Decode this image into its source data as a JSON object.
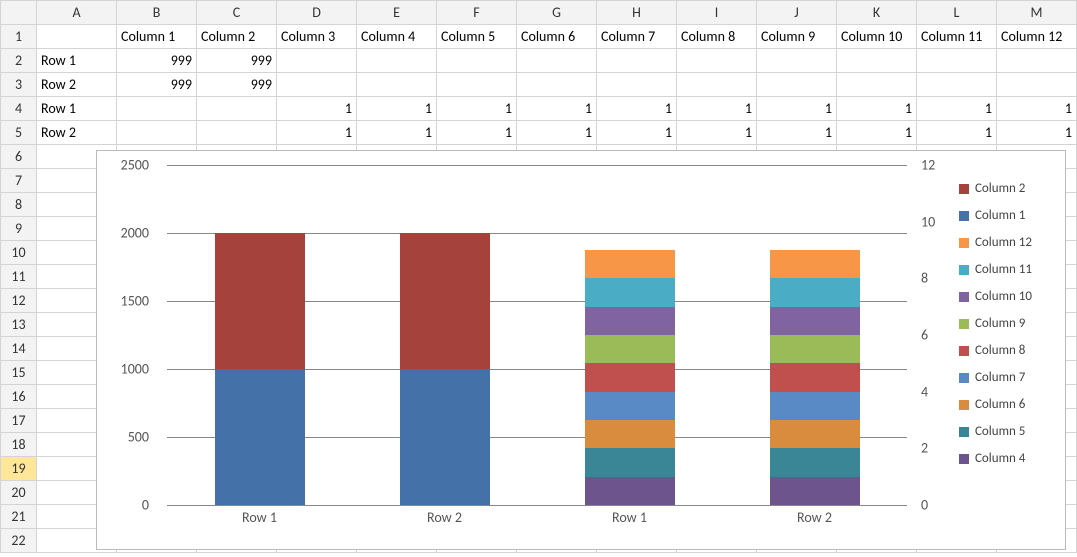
{
  "spreadsheet": {
    "col_headers": [
      "A",
      "B",
      "C",
      "D",
      "E",
      "F",
      "G",
      "H",
      "I",
      "J",
      "K",
      "L",
      "M"
    ],
    "row_headers": [
      "1",
      "2",
      "3",
      "4",
      "5",
      "6",
      "7",
      "8",
      "9",
      "10",
      "11",
      "12",
      "13",
      "14",
      "15",
      "16",
      "17",
      "18",
      "19",
      "20",
      "21",
      "22"
    ],
    "selected_row": "19",
    "header_row": {
      "B": "Column 1",
      "C": "Column 2",
      "D": "Column 3",
      "E": "Column 4",
      "F": "Column 5",
      "G": "Column 6",
      "H": "Column 7",
      "I": "Column 8",
      "J": "Column 9",
      "K": "Column 10",
      "L": "Column 11",
      "M": "Column 12"
    },
    "rows": {
      "2": {
        "A": "Row 1",
        "B": "999",
        "C": "999"
      },
      "3": {
        "A": "Row 2",
        "B": "999",
        "C": "999"
      },
      "4": {
        "A": "Row 1",
        "D": "1",
        "E": "1",
        "F": "1",
        "G": "1",
        "H": "1",
        "I": "1",
        "J": "1",
        "K": "1",
        "L": "1",
        "M": "1"
      },
      "5": {
        "A": "Row 2",
        "D": "1",
        "E": "1",
        "F": "1",
        "G": "1",
        "H": "1",
        "I": "1",
        "J": "1",
        "K": "1",
        "L": "1",
        "M": "1"
      }
    }
  },
  "chart_data": {
    "type": "bar",
    "stacked": true,
    "categories_left": [
      "Row 1",
      "Row 2"
    ],
    "categories_right": [
      "Row 1",
      "Row 2"
    ],
    "y_left": {
      "min": 0,
      "max": 2500,
      "ticks": [
        0,
        500,
        1000,
        1500,
        2000,
        2500
      ]
    },
    "y_right": {
      "min": 0,
      "max": 12,
      "ticks": [
        0,
        2,
        4,
        6,
        8,
        10,
        12
      ]
    },
    "series_left": [
      {
        "name": "Column 1",
        "color": "#4472a8",
        "values": [
          999,
          999
        ]
      },
      {
        "name": "Column 2",
        "color": "#a5423b",
        "values": [
          999,
          999
        ]
      }
    ],
    "series_right": [
      {
        "name": "Column 4",
        "color": "#6e548d",
        "values": [
          1,
          1
        ]
      },
      {
        "name": "Column 5",
        "color": "#3b8696",
        "values": [
          1,
          1
        ]
      },
      {
        "name": "Column 6",
        "color": "#d98b3e",
        "values": [
          1,
          1
        ]
      },
      {
        "name": "Column 7",
        "color": "#5a8ac6",
        "values": [
          1,
          1
        ]
      },
      {
        "name": "Column 8",
        "color": "#c0504d",
        "values": [
          1,
          1
        ]
      },
      {
        "name": "Column 9",
        "color": "#9bbb59",
        "values": [
          1,
          1
        ]
      },
      {
        "name": "Column 10",
        "color": "#8064a2",
        "values": [
          1,
          1
        ]
      },
      {
        "name": "Column 11",
        "color": "#4bacc6",
        "values": [
          1,
          1
        ]
      },
      {
        "name": "Column 12",
        "color": "#f79646",
        "values": [
          1,
          1
        ]
      }
    ],
    "legend_order": [
      {
        "name": "Column 2",
        "color": "#a5423b"
      },
      {
        "name": "Column 1",
        "color": "#4472a8"
      },
      {
        "name": "Column 12",
        "color": "#f79646"
      },
      {
        "name": "Column 11",
        "color": "#4bacc6"
      },
      {
        "name": "Column 10",
        "color": "#8064a2"
      },
      {
        "name": "Column 9",
        "color": "#9bbb59"
      },
      {
        "name": "Column 8",
        "color": "#c0504d"
      },
      {
        "name": "Column 7",
        "color": "#5a8ac6"
      },
      {
        "name": "Column 6",
        "color": "#d98b3e"
      },
      {
        "name": "Column 5",
        "color": "#3b8696"
      },
      {
        "name": "Column 4",
        "color": "#6e548d"
      }
    ]
  }
}
